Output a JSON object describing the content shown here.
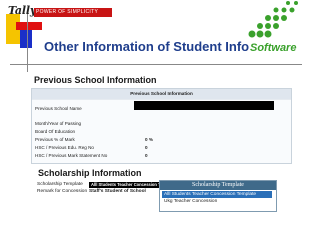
{
  "header": {
    "tally_brand": "Tally",
    "tally_tagline": "POWER OF SIMPLICITY",
    "title": "Other Information of Student Info",
    "software_logo": "Software"
  },
  "previous_school": {
    "heading": "Previous School Information",
    "form_title": "Previous School Information",
    "rows": [
      {
        "label": "Previous School Name",
        "value": ""
      },
      {
        "label": "Month/Year of Passing",
        "value": ""
      },
      {
        "label": "Board Of Education",
        "value": ""
      },
      {
        "label": "Previous % of Mark",
        "value": "0 %"
      },
      {
        "label": "HSC / Previous Edu. Reg No",
        "value": "0"
      },
      {
        "label": "HSC / Previous Mark Statement No",
        "value": "0"
      }
    ]
  },
  "scholarship": {
    "heading": "Scholarship Information",
    "template_label": "Scholarship Template",
    "template_value": "Alll Students Teacher Concession Template",
    "remark_label": "Remark for Concession",
    "remark_value": "Staff's Student of School",
    "panel_title": "Scholarship Template",
    "options": [
      {
        "label": "Alll Students Teacher Concession Template",
        "selected": true
      },
      {
        "label": "Ukg Teacher Concession",
        "selected": false
      }
    ]
  }
}
